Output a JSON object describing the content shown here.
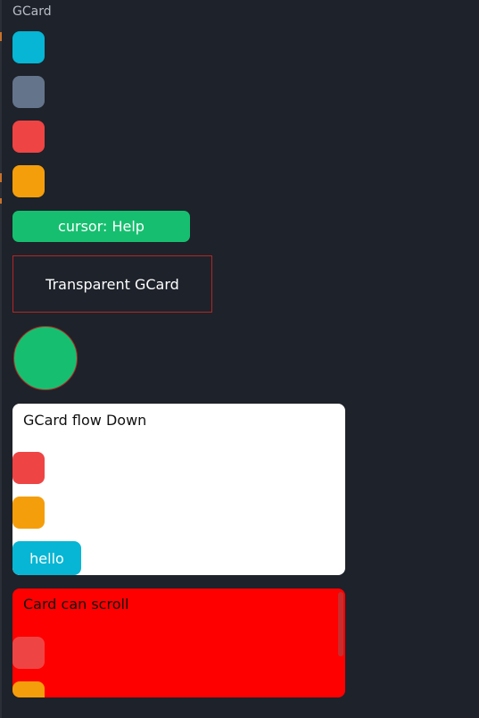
{
  "section": {
    "title": "GCard"
  },
  "colors": {
    "background": "#1e222a",
    "cyan": "#06b6d4",
    "slate": "#64748b",
    "red": "#ef4444",
    "orange": "#f59e0b",
    "green": "#16bf6f",
    "white": "#ffffff",
    "pure_red": "#ff0000",
    "border_red": "#b32626"
  },
  "squares": [
    {
      "name": "cyan-square",
      "color": "#06b6d4"
    },
    {
      "name": "slate-square",
      "color": "#64748b"
    },
    {
      "name": "red-square",
      "color": "#ef4444"
    },
    {
      "name": "orange-square",
      "color": "#f59e0b"
    }
  ],
  "cursor_button": {
    "label": "cursor: Help"
  },
  "transparent_card": {
    "label": "Transparent GCard"
  },
  "flow_card": {
    "title": "GCard flow Down",
    "button_label": "hello"
  },
  "scroll_card": {
    "title": "Card can scroll"
  }
}
